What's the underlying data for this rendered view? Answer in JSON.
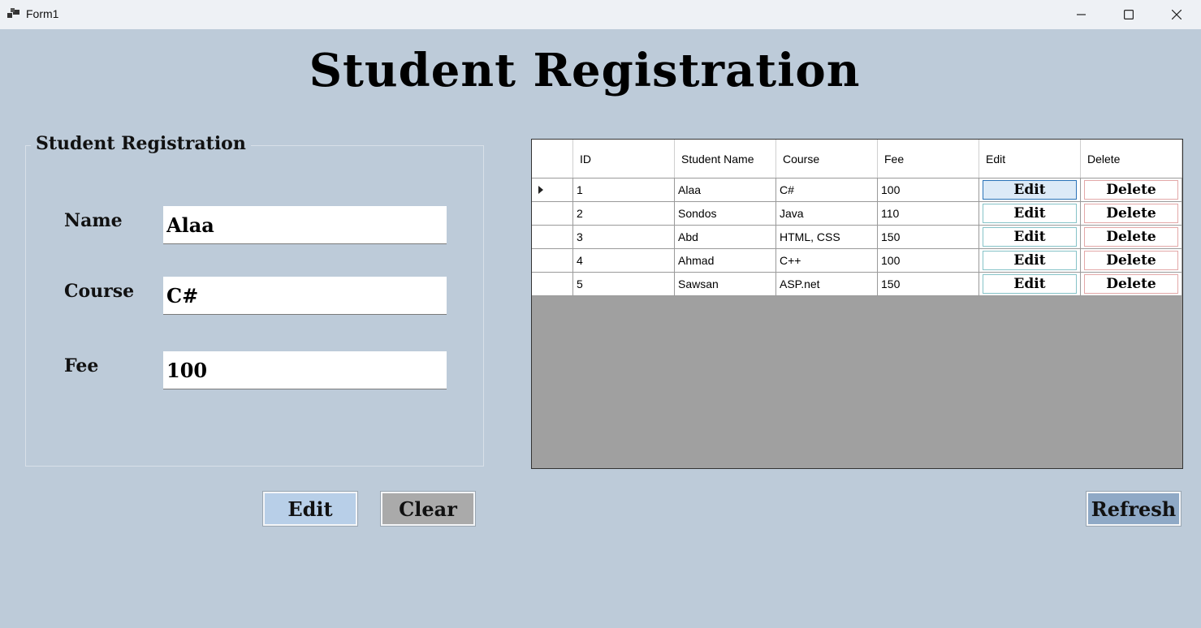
{
  "window": {
    "title": "Form1",
    "icon": "app-window-icon",
    "controls": [
      "minimize-icon",
      "maximize-icon",
      "close-icon"
    ]
  },
  "header": {
    "title": "Student Registration"
  },
  "form": {
    "group_title": "Student Registration",
    "name_label": "Name",
    "name_value": "Alaa",
    "course_label": "Course",
    "course_value": "C#",
    "fee_label": "Fee",
    "fee_value": "100"
  },
  "buttons": {
    "edit_label": "Edit",
    "clear_label": "Clear",
    "refresh_label": "Refresh"
  },
  "grid": {
    "columns": [
      "ID",
      "Student Name",
      "Course",
      "Fee",
      "Edit",
      "Delete"
    ],
    "rows": [
      {
        "id": "1",
        "name": "Alaa",
        "course": "C#",
        "fee": "100",
        "edit": "Edit",
        "delete": "Delete"
      },
      {
        "id": "2",
        "name": "Sondos",
        "course": "Java",
        "fee": "110",
        "edit": "Edit",
        "delete": "Delete"
      },
      {
        "id": "3",
        "name": "Abd",
        "course": "HTML, CSS",
        "fee": "150",
        "edit": "Edit",
        "delete": "Delete"
      },
      {
        "id": "4",
        "name": "Ahmad",
        "course": "C++",
        "fee": "100",
        "edit": "Edit",
        "delete": "Delete"
      },
      {
        "id": "5",
        "name": "Sawsan",
        "course": "ASP.net",
        "fee": "150",
        "edit": "Edit",
        "delete": "Delete"
      }
    ],
    "selected_row": 0
  },
  "colors": {
    "background": "#bdcbd9",
    "edit_button": "#b8cfe8",
    "clear_button": "#aaaaaa",
    "refresh_button": "#8fa9c6",
    "grid_empty": "#a0a0a0"
  }
}
